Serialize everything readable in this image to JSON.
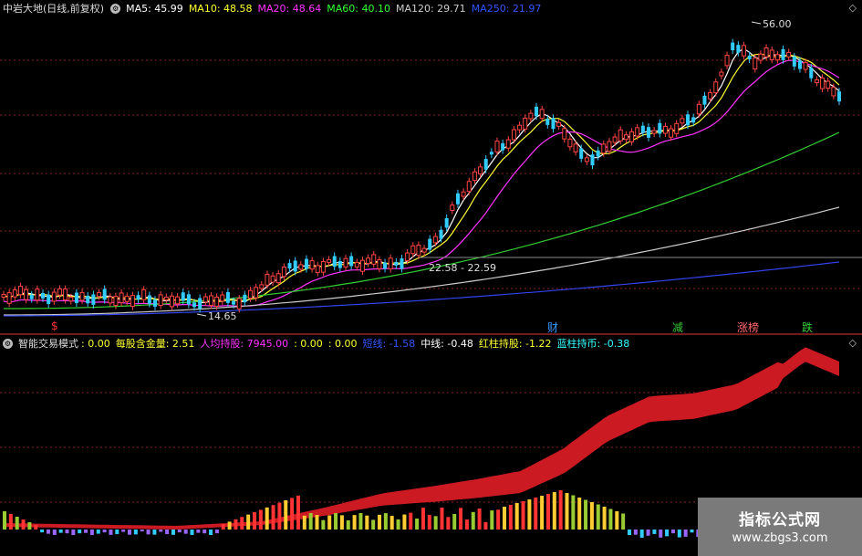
{
  "title": "中岩大地(日线,前复权)",
  "ma_legend": [
    {
      "label": "MA5: 45.99",
      "color": "#ffffff"
    },
    {
      "label": "MA10: 48.58",
      "color": "#ffff33"
    },
    {
      "label": "MA20: 48.64",
      "color": "#ff33ff"
    },
    {
      "label": "MA60: 40.10",
      "color": "#33ff33"
    },
    {
      "label": "MA120: 29.71",
      "color": "#cccccc"
    },
    {
      "label": "MA250: 21.97",
      "color": "#3355ff"
    }
  ],
  "price_labels": {
    "high": "56.00",
    "mid": "22.58 - 22.59",
    "low": "14.65"
  },
  "events": [
    {
      "label": "$",
      "color": "#ff3333"
    },
    {
      "label": "财",
      "color": "#3399ff"
    },
    {
      "label": "减",
      "color": "#33cc33"
    },
    {
      "label": "涨榜",
      "color": "#ff6666"
    },
    {
      "label": "跌",
      "color": "#33cc33"
    }
  ],
  "indicator_name": "智能交易模式",
  "indicator_items": [
    {
      "label": ": 0.00",
      "color": "#ffff33"
    },
    {
      "label": "每股含金量: 2.51",
      "color": "#ffff33"
    },
    {
      "label": "人均持股: 7945.00",
      "color": "#ff33ff"
    },
    {
      "label": ": 0.00",
      "color": "#ffff33"
    },
    {
      "label": ": 0.00",
      "color": "#ffff33"
    },
    {
      "label": "短线: -1.58",
      "color": "#3355ff"
    },
    {
      "label": "中线: -0.48",
      "color": "#ffffff"
    },
    {
      "label": "红柱持股: -1.22",
      "color": "#ffff33"
    },
    {
      "label": "蓝柱持币: -0.38",
      "color": "#33ffff"
    }
  ],
  "icons": {
    "settings": "gear-icon",
    "nav_up": "◇",
    "nav_down": "◇"
  },
  "watermark": {
    "line1": "指标公式网",
    "line2": "www.zbgs3.com"
  }
}
